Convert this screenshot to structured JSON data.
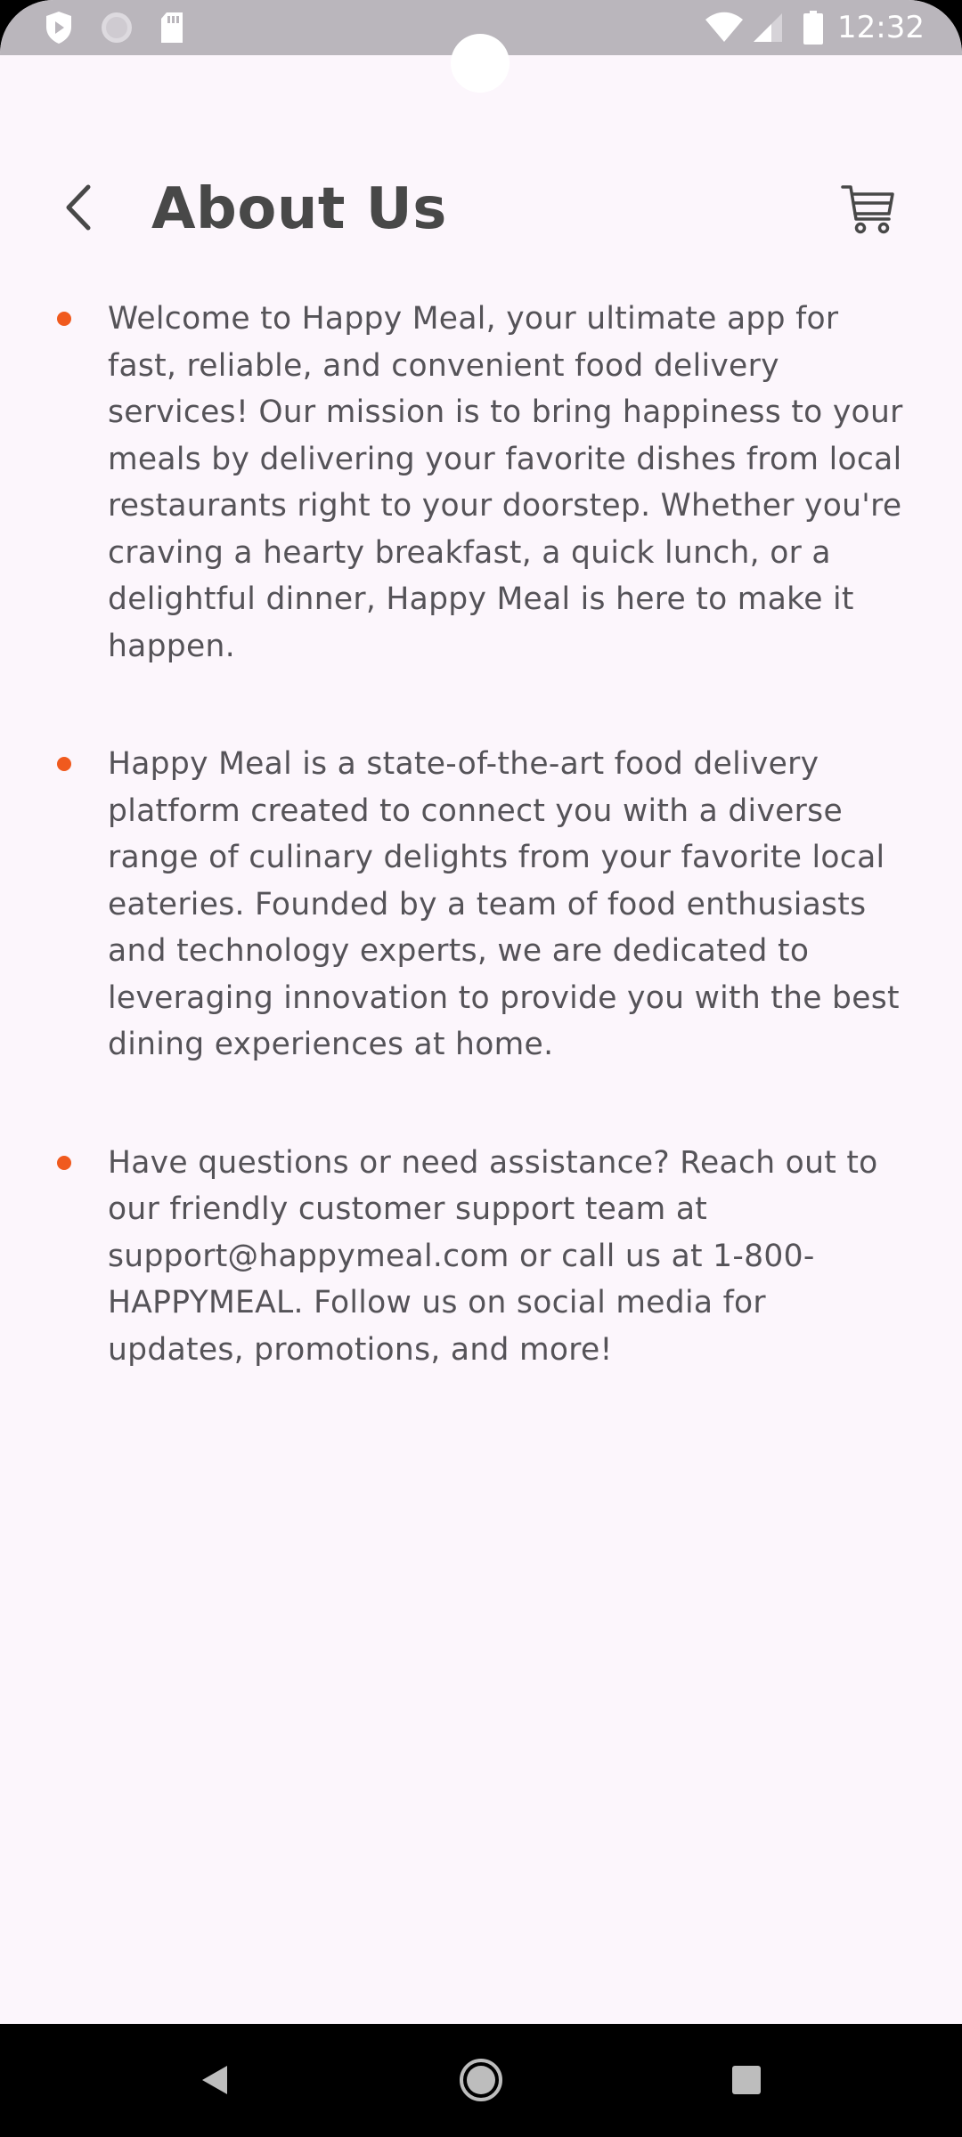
{
  "status_bar": {
    "time": "12:32",
    "icons": [
      "shield-icon",
      "circle-icon",
      "sd-card-icon",
      "wifi-icon",
      "signal-icon",
      "battery-icon"
    ]
  },
  "header": {
    "title": "About Us",
    "back_icon": "chevron-left-icon",
    "cart_icon": "cart-icon"
  },
  "bullets": [
    {
      "text": "Welcome to Happy Meal, your ultimate app for fast, reliable, and convenient food delivery services! Our mission is to bring happiness to your meals by delivering your favorite dishes from local restaurants right to your doorstep. Whether you're craving a hearty breakfast, a quick lunch, or a delightful dinner, Happy Meal is here to make it happen."
    },
    {
      "text": "Happy Meal is a state-of-the-art food delivery platform created to connect you with a diverse range of culinary delights from your favorite local eateries. Founded by a team of food enthusiasts and technology experts, we are dedicated to leveraging innovation to provide you with the best dining experiences at home."
    },
    {
      "text": "Have questions or need assistance? Reach out to our friendly customer support team at support@happymeal.com or call us at 1-800-HAPPYMEAL. Follow us on social media for updates, promotions, and more!"
    }
  ],
  "colors": {
    "background": "#fcf6fc",
    "accent_bullet": "#f05a1e",
    "text": "#555358",
    "title": "#484848",
    "status_bar": "#bab6bc"
  },
  "nav_bar": {
    "icons": [
      "back-triangle-icon",
      "home-circle-icon",
      "recents-square-icon"
    ]
  }
}
